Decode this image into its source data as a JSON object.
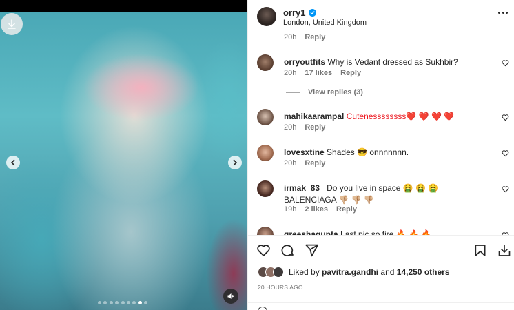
{
  "post": {
    "username": "orry1",
    "location": "London, United Kingdom"
  },
  "media": {
    "dots_total": 9,
    "active_dot": 7
  },
  "comments": {
    "prev_meta": {
      "time": "20h",
      "reply": "Reply"
    },
    "items": [
      {
        "user": "orryoutfits",
        "text": "Why is Vedant dressed as Sukhbir?",
        "time": "20h",
        "likes": "17 likes",
        "reply": "Reply"
      },
      {
        "user": "mahikaarampal",
        "text": "Cutenessssssss❤️ ❤️ ❤️ ❤️",
        "time": "20h",
        "reply": "Reply"
      },
      {
        "user": "lovesxtine",
        "text": "Shades 😎 onnnnnnn.",
        "time": "20h",
        "reply": "Reply"
      },
      {
        "user": "irmak_83_",
        "text": "Do you live in space 🤮 🤮 🤮 BALENCIAGA 👎🏼 👎🏼 👎🏼",
        "time": "19h",
        "likes": "2 likes",
        "reply": "Reply"
      },
      {
        "user": "greeshagupta",
        "text": "Last pic so fire 🔥 🔥 🔥"
      }
    ],
    "view_replies": "View replies (3)"
  },
  "likes": {
    "prefix": "Liked by",
    "liker": "pavitra.gandhi",
    "and": "and",
    "others": "14,250 others"
  },
  "timestamp": "20 HOURS AGO",
  "colors": {
    "verified": "#0095f6",
    "text": "#262626",
    "muted": "#737373"
  }
}
